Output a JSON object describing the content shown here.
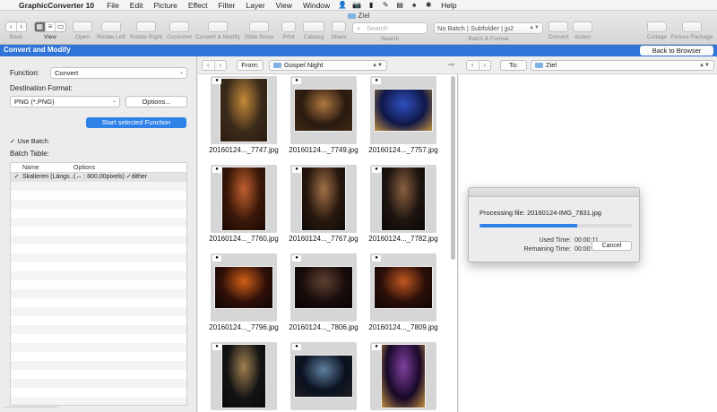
{
  "menubar": {
    "app_name": "GraphicConverter 10",
    "items": [
      "File",
      "Edit",
      "Picture",
      "Effect",
      "Filter",
      "Layer",
      "View",
      "Window",
      "Help"
    ],
    "tray_icons": [
      "user-icon",
      "camera-icon",
      "clipboard-icon",
      "pencil-icon",
      "layers-icon",
      "puzzle-icon",
      "gear-icon"
    ]
  },
  "window": {
    "title": "Ziel"
  },
  "toolbar": {
    "back": "Back",
    "view": "View",
    "open": "Open",
    "rotate_left": "Rotate Left",
    "rotate_right": "Rotate Right",
    "cocoonet": "Cocoonet",
    "convert_modify": "Convert & Modify",
    "slide_show": "Slide Show",
    "print": "Print",
    "catalog": "Catalog",
    "share": "Share",
    "search_label": "Search",
    "search_placeholder": "Search",
    "batch_select": "No Batch | Subfolder | jp2",
    "batch_format": "Batch & Format",
    "convert": "Convert",
    "action": "Action",
    "collage": "Collage",
    "picture_package": "Picture Package"
  },
  "header": {
    "title": "Convert and Modify",
    "back_to_browser": "Back to Browser"
  },
  "left": {
    "function_label": "Function:",
    "function_value": "Convert",
    "dest_label": "Destination Format:",
    "dest_value": "PNG (*.PNG)",
    "options_button": "Options...",
    "start_button": "Start selected Function",
    "use_batch_label": "Use Batch",
    "batch_table_label": "Batch Table:",
    "table": {
      "col_name": "Name",
      "col_options": "Options",
      "rows": [
        {
          "name": "Skalieren (Längs...",
          "options": "(↔ : 800.00pixels)  ✓dither"
        }
      ]
    }
  },
  "middle": {
    "from_label": "From:",
    "path": "Gospel Night",
    "thumbs": [
      {
        "caption": "20160124..._7747.jpg",
        "palette": [
          "#3a2a1a",
          "#c58a3a",
          "#2a1c10"
        ]
      },
      {
        "caption": "20160124..._7749.jpg",
        "palette": [
          "#2a1a10",
          "#b07840",
          "#3c2814"
        ]
      },
      {
        "caption": "20160124..._7757.jpg",
        "palette": [
          "#101848",
          "#3050c0",
          "#c09040"
        ]
      },
      {
        "caption": "20160124..._7760.jpg",
        "palette": [
          "#3a1808",
          "#c06030",
          "#1a0a05"
        ]
      },
      {
        "caption": "20160124..._7767.jpg",
        "palette": [
          "#28180e",
          "#a07048",
          "#0e0a08"
        ]
      },
      {
        "caption": "20160124..._7782.jpg",
        "palette": [
          "#1e1410",
          "#8a6040",
          "#0a0805"
        ]
      },
      {
        "caption": "20160124..._7796.jpg",
        "palette": [
          "#301008",
          "#d06018",
          "#0e0604"
        ]
      },
      {
        "caption": "20160124..._7806.jpg",
        "palette": [
          "#180c0c",
          "#604030",
          "#080404"
        ]
      },
      {
        "caption": "20160124..._7809.jpg",
        "palette": [
          "#2a0e08",
          "#c05820",
          "#100604"
        ]
      },
      {
        "caption": "",
        "palette": [
          "#141414",
          "#a08050",
          "#080808"
        ]
      },
      {
        "caption": "",
        "palette": [
          "#0a1020",
          "#6080a0",
          "#202020"
        ]
      },
      {
        "caption": "",
        "palette": [
          "#180828",
          "#8040a0",
          "#c09040"
        ]
      }
    ]
  },
  "right": {
    "to_label": "To:",
    "path": "Ziel"
  },
  "dialog": {
    "processing": "Processing file: 20160124-IMG_7831.jpg",
    "progress": 0.64,
    "used_label": "Used Time:",
    "used_value": "00:00:11",
    "remaining_label": "Remaining Time:",
    "remaining_value": "00:00:05",
    "cancel": "Cancel"
  }
}
